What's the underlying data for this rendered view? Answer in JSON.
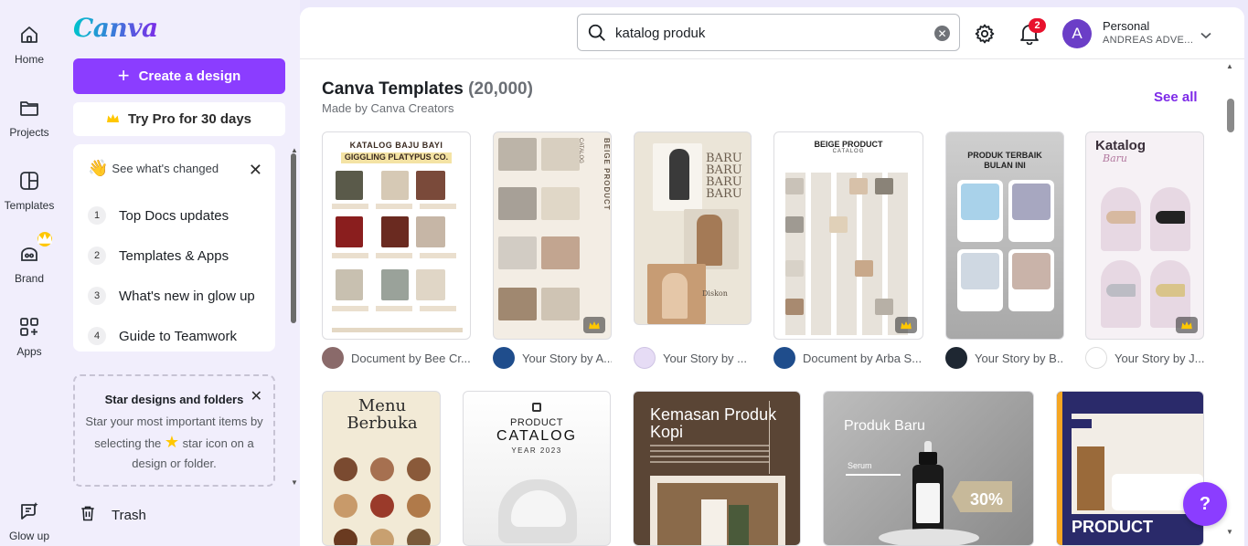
{
  "rail": {
    "items": [
      {
        "label": "Home",
        "icon": "home-icon"
      },
      {
        "label": "Projects",
        "icon": "folder-icon"
      },
      {
        "label": "Templates",
        "icon": "templates-icon"
      },
      {
        "label": "Brand",
        "icon": "brand-icon"
      },
      {
        "label": "Apps",
        "icon": "apps-icon"
      },
      {
        "label": "Glow up",
        "icon": "glow-up-icon"
      }
    ]
  },
  "sidebar": {
    "logo": "Canva",
    "create_label": "Create a design",
    "trypro_label": "Try Pro for 30 days",
    "changes": {
      "title": "See what's changed",
      "items": [
        {
          "num": "1",
          "label": "Top Docs updates"
        },
        {
          "num": "2",
          "label": "Templates & Apps"
        },
        {
          "num": "3",
          "label": "What's new in glow up"
        },
        {
          "num": "4",
          "label": "Guide to Teamwork"
        }
      ]
    },
    "star_card": {
      "title": "Star designs and folders",
      "body_1": "Star your most important items by selecting the",
      "body_2": "star icon on a design or folder."
    },
    "trash_label": "Trash"
  },
  "header": {
    "search_value": "katalog produk",
    "notification_count": "2",
    "avatar_letter": "A",
    "account_type": "Personal",
    "account_name": "ANDREAS ADVE..."
  },
  "section": {
    "title": "Canva Templates",
    "count": "(20,000)",
    "subtitle": "Made by Canva Creators",
    "see_all": "See all"
  },
  "templates_row1": [
    {
      "creator": "Document by Bee Cr...",
      "thumb_title": "KATALOG BAJU BAYI",
      "thumb_sub": "GIGGLING PLATYPUS CO.",
      "pro": false
    },
    {
      "creator": "Your Story by A...",
      "thumb_title": "BEIGE PRODUCT",
      "thumb_sub": "CATALOG",
      "pro": true
    },
    {
      "creator": "Your Story by ...",
      "thumb_title": "BARU BARU BARU BARU",
      "thumb_sub": "Diskon",
      "pro": false
    },
    {
      "creator": "Document by Arba S...",
      "thumb_title": "BEIGE PRODUCT",
      "thumb_sub": "CATALOG",
      "pro": true
    },
    {
      "creator": "Your Story by B...",
      "thumb_title": "PRODUK TERBAIK BULAN INI",
      "thumb_sub": "",
      "pro": false
    },
    {
      "creator": "Your Story by J...",
      "thumb_title": "Katalog",
      "thumb_sub": "Baru",
      "pro": true
    }
  ],
  "templates_row2": [
    {
      "thumb_title": "Menu Berbuka"
    },
    {
      "thumb_title": "CATALOG",
      "thumb_sub": "PRODUCT",
      "thumb_year": "YEAR 2023"
    },
    {
      "thumb_title": "Kemasan Produk Kopi"
    },
    {
      "thumb_title": "Produk Baru",
      "thumb_sub": "Serum",
      "thumb_pct": "30%"
    },
    {
      "thumb_title": "PRODUCT"
    }
  ],
  "help_label": "?",
  "colors": {
    "brand_purple": "#8b3dff",
    "link_purple": "#7d2ae8",
    "badge_red": "#e8112d",
    "crown_gold": "#ffc700"
  }
}
